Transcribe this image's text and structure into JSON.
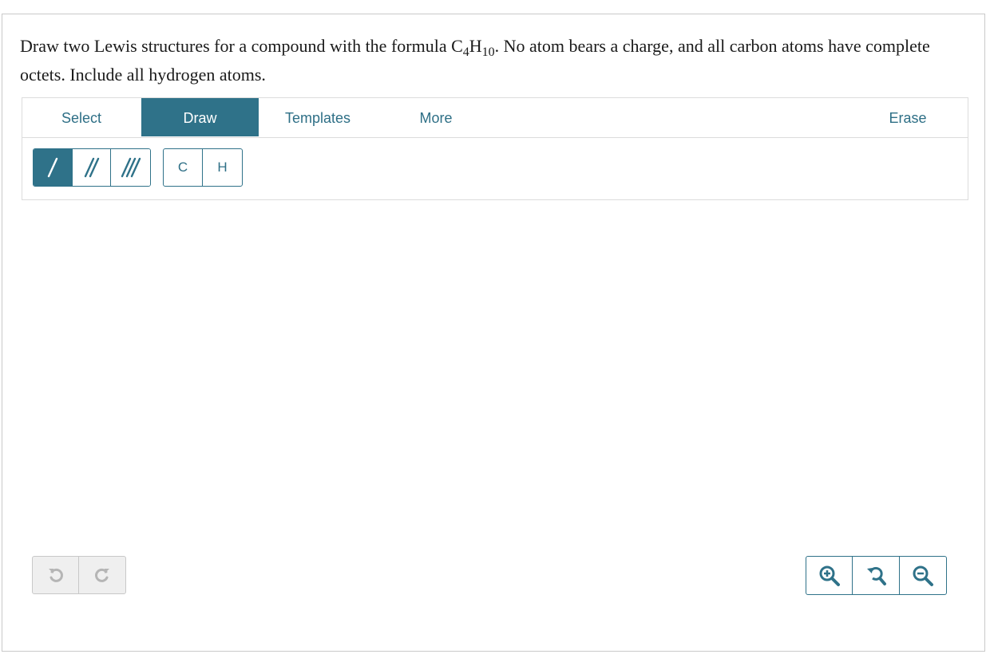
{
  "question": {
    "part1": "Draw two Lewis structures for a compound with the formula C",
    "sub1": "4",
    "part2": "H",
    "sub2": "10",
    "part3": ". No atom bears a charge, and all carbon atoms have complete octets. Include all hydrogen atoms."
  },
  "tabs": {
    "select": "Select",
    "draw": "Draw",
    "templates": "Templates",
    "more": "More",
    "erase": "Erase"
  },
  "atoms": {
    "carbon": "C",
    "hydrogen": "H"
  },
  "icons": {
    "single_bond": "single-bond-icon",
    "double_bond": "double-bond-icon",
    "triple_bond": "triple-bond-icon",
    "undo": "undo-icon",
    "redo": "redo-icon",
    "zoom_in": "zoom-in-icon",
    "zoom_reset": "zoom-reset-icon",
    "zoom_out": "zoom-out-icon"
  },
  "colors": {
    "accent": "#2f7289",
    "accent_text": "#2e6f86",
    "border": "#dcdcdc",
    "disabled": "#efefef",
    "disabled_icon": "#b5b5b5"
  }
}
